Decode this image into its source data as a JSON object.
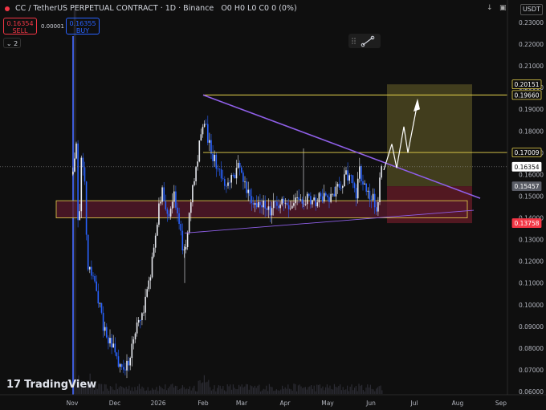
{
  "header": {
    "symbol": "CC / TetherUS PERPETUAL CONTRACT · 1D · Binance",
    "ohlc": "O0 H0 L0 C0 0 (0%)"
  },
  "trade": {
    "sell_price": "0.16354",
    "sell_label": "SELL",
    "spread": "0.00001",
    "buy_price": "0.16355",
    "buy_label": "BUY"
  },
  "indicators_count": "2",
  "currency": "USDT",
  "watermark": "TradingView",
  "price_axis": {
    "ticks": [
      "0.23000",
      "0.22000",
      "0.21000",
      "0.20000",
      "0.19000",
      "0.18000",
      "0.17000",
      "0.16000",
      "0.15000",
      "0.14000",
      "0.13000",
      "0.12000",
      "0.11000",
      "0.10000",
      "0.09000",
      "0.08000",
      "0.07000",
      "0.06000"
    ],
    "labels": [
      {
        "value": "0.20151",
        "price": 0.20151,
        "style": "outline-yellow"
      },
      {
        "value": "0.19660",
        "price": 0.1966,
        "style": "outline-yellow"
      },
      {
        "value": "0.17009",
        "price": 0.17009,
        "style": "outline-yellow"
      },
      {
        "value": "0.16354",
        "price": 0.16354,
        "style": "white"
      },
      {
        "value": "0.15457",
        "price": 0.15457,
        "style": "gray"
      },
      {
        "value": "0.13758",
        "price": 0.13758,
        "style": "red"
      }
    ]
  },
  "time_axis": [
    "Nov",
    "Dec",
    "2026",
    "Feb",
    "Mar",
    "Apr",
    "May",
    "Jun",
    "Jul",
    "Aug",
    "Sep"
  ],
  "colors": {
    "bg": "#0f0f0f",
    "candle": "#dfe3eb",
    "volume": "#2b2b33",
    "trendline": "#8f5fe8",
    "level": "#e8d44d",
    "zone_fill": "#5a1a2c",
    "target_fill": "#4a4520",
    "stop_fill": "#5e1a25"
  },
  "chart_data": {
    "type": "candlestick",
    "ylim": [
      0.058,
      0.236
    ],
    "levels": [
      0.1966,
      0.17009
    ],
    "position": {
      "entry": 0.15457,
      "target": 0.20151,
      "stop": 0.13758
    }
  }
}
